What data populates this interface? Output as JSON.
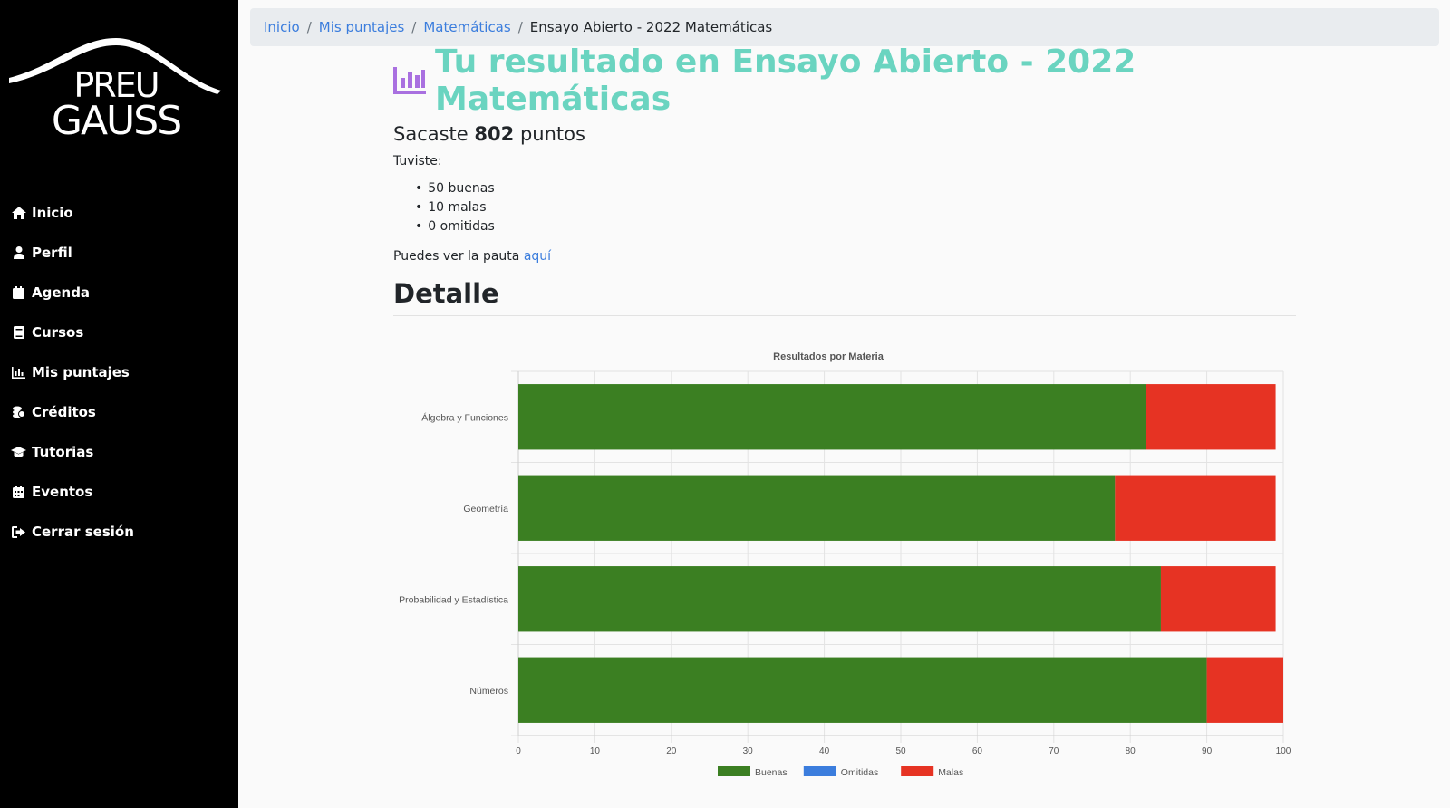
{
  "sidebar": {
    "logo_line1": "PREU",
    "logo_line2": "GAUSS",
    "items": [
      {
        "label": "Inicio",
        "icon": "home-icon"
      },
      {
        "label": "Perfil",
        "icon": "user-icon"
      },
      {
        "label": "Agenda",
        "icon": "calendar-icon"
      },
      {
        "label": "Cursos",
        "icon": "book-icon"
      },
      {
        "label": "Mis puntajes",
        "icon": "chart-icon"
      },
      {
        "label": "Créditos",
        "icon": "coins-icon"
      },
      {
        "label": "Tutorias",
        "icon": "graduation-cap-icon"
      },
      {
        "label": "Eventos",
        "icon": "calendar-grid-icon"
      },
      {
        "label": "Cerrar sesión",
        "icon": "sign-out-icon"
      }
    ]
  },
  "breadcrumb": {
    "items": [
      "Inicio",
      "Mis puntajes",
      "Matemáticas"
    ],
    "current": "Ensayo Abierto - 2022 Matemáticas"
  },
  "main": {
    "title": "Tu resultado en Ensayo Abierto - 2022 Matemáticas",
    "score_prefix": "Sacaste",
    "score_value": "802",
    "score_suffix": "puntos",
    "tuviste": "Tuviste:",
    "results": [
      "50 buenas",
      "10 malas",
      "0 omitidas"
    ],
    "pauta_text": "Puedes ver la pauta",
    "pauta_link": "aquí",
    "detalle": "Detalle",
    "title_color": "#6ad4c0",
    "icon_color": "#a970e0"
  },
  "chart_data": {
    "type": "bar",
    "orientation": "horizontal",
    "stacked": true,
    "title": "Resultados por Materia",
    "categories": [
      "Álgebra y Funciones",
      "Geometría",
      "Probabilidad y Estadística",
      "Números"
    ],
    "series": [
      {
        "name": "Buenas",
        "color": "#3b7f22",
        "values": [
          82,
          78,
          84,
          90
        ]
      },
      {
        "name": "Omitidas",
        "color": "#3b7ddd",
        "values": [
          0,
          0,
          0,
          0
        ]
      },
      {
        "name": "Malas",
        "color": "#e63323",
        "values": [
          17,
          21,
          15,
          10
        ]
      }
    ],
    "xlim": [
      0,
      100
    ],
    "xticks": [
      0,
      10,
      20,
      30,
      40,
      50,
      60,
      70,
      80,
      90,
      100
    ],
    "grid": true,
    "legend": "bottom"
  }
}
